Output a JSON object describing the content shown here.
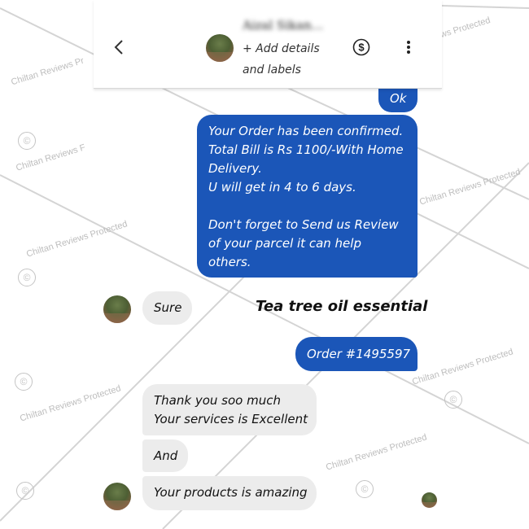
{
  "header": {
    "contact_name": "Aizal Sikan...",
    "add_details": "+ Add details\nand labels",
    "back_icon": "chevron-left-icon",
    "payment_icon": "dollar-circle-icon",
    "more_icon": "more-vertical-icon"
  },
  "messages": [
    {
      "from": "me",
      "text": "Ok"
    },
    {
      "from": "me",
      "text": "Your Order has been confirmed.\nTotal Bill is Rs 1100/-With Home\nDelivery.\nU will get in 4 to 6 days.\n\nDon't forget to Send us Review\nof your parcel it can help\nothers."
    },
    {
      "from": "them",
      "text": "Sure"
    },
    {
      "from": "me",
      "text": "Order #1495597"
    },
    {
      "from": "them",
      "text": "Thank you soo much\nYour services is Excellent"
    },
    {
      "from": "them",
      "text": "And"
    },
    {
      "from": "them",
      "text": "Your products is amazing"
    }
  ],
  "caption": "Tea tree oil essential",
  "watermarks": {
    "text_full": "Chiltan Reviews Protected",
    "text_short_1": "Chiltan Reviews Pr",
    "text_short_2": "Chiltan Reviews F",
    "text_short_3": "ws Protected",
    "copyright_symbol": "©"
  },
  "colors": {
    "outgoing_bubble": "#1b56b8",
    "incoming_bubble": "#ececec"
  }
}
